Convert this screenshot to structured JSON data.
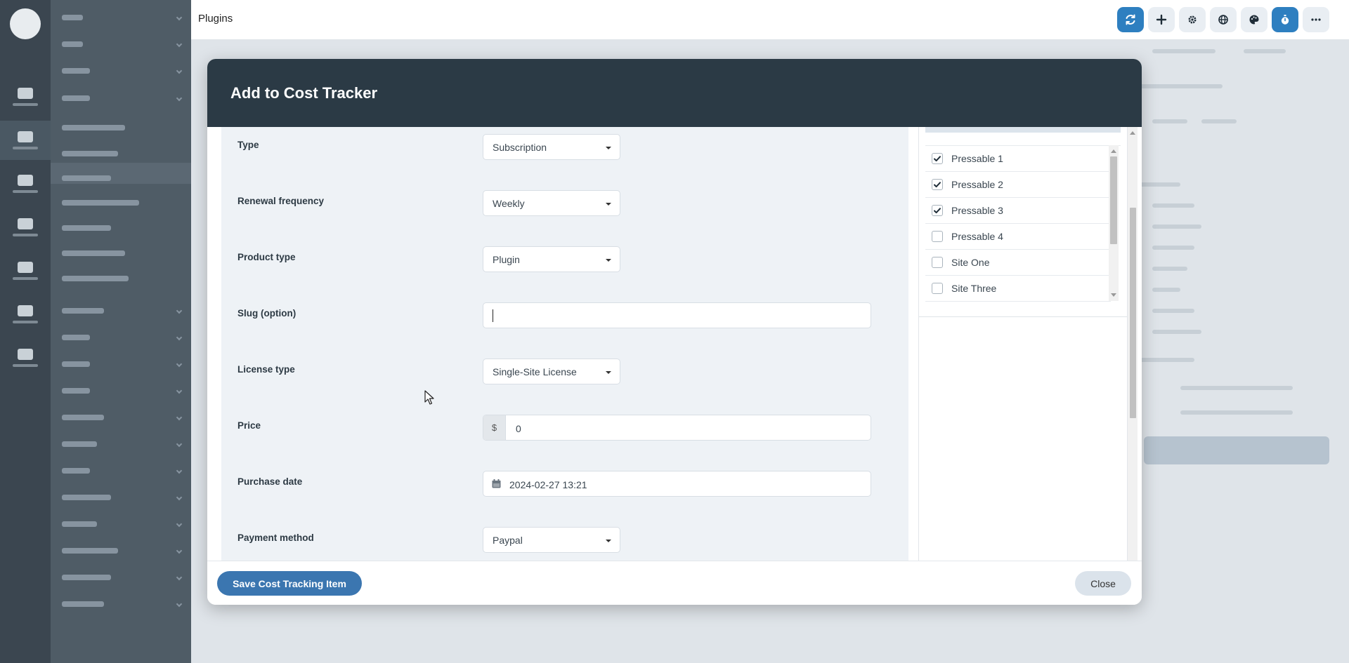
{
  "topbar": {
    "title": "Plugins",
    "actions": [
      {
        "name": "sync-icon",
        "color": "#2e7fc0"
      },
      {
        "name": "plus-icon"
      },
      {
        "name": "gear-icon"
      },
      {
        "name": "globe-icon"
      },
      {
        "name": "palette-icon"
      },
      {
        "name": "stopwatch-icon",
        "color": "#2e7fc0"
      },
      {
        "name": "more-icon"
      }
    ]
  },
  "modal": {
    "title": "Add to Cost Tracker",
    "fields": {
      "type": {
        "label": "Type",
        "value": "Subscription"
      },
      "renewal": {
        "label": "Renewal frequency",
        "value": "Weekly"
      },
      "product_type": {
        "label": "Product type",
        "value": "Plugin"
      },
      "slug": {
        "label": "Slug (option)",
        "value": ""
      },
      "license": {
        "label": "License type",
        "value": "Single-Site License"
      },
      "price": {
        "label": "Price",
        "prefix": "$",
        "value": "0"
      },
      "purchase_date": {
        "label": "Purchase date",
        "value": "2024-02-27 13:21"
      },
      "payment": {
        "label": "Payment method",
        "value": "Paypal"
      }
    },
    "sites": [
      {
        "name": "Pressable 1",
        "checked": true
      },
      {
        "name": "Pressable 2",
        "checked": true
      },
      {
        "name": "Pressable 3",
        "checked": true
      },
      {
        "name": "Pressable 4",
        "checked": false
      },
      {
        "name": "Site One",
        "checked": false
      },
      {
        "name": "Site Three",
        "checked": false
      }
    ],
    "save_label": "Save Cost Tracking Item",
    "close_label": "Close"
  },
  "colors": {
    "header_bg": "#2b3a45",
    "primary_button": "#3b76b0",
    "accent": "#2e7fc0"
  }
}
